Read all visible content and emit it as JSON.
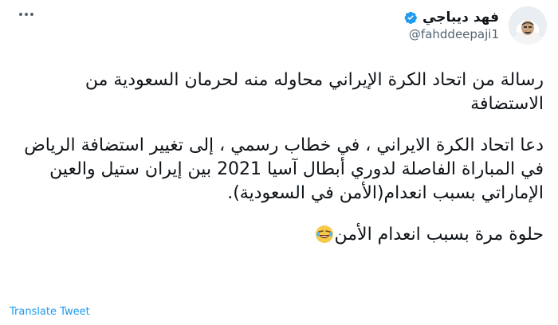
{
  "tweet": {
    "author": {
      "display_name": "فهد ديباجي",
      "handle": "@fahddeepaji1",
      "verified": true
    },
    "paragraphs": [
      "رسالة من اتحاد الكرة الإيراني محاوله منه لحرمان السعودية من الاستضافة",
      "دعا اتحاد الكرة الايراني ، في خطاب رسمي ، إلى تغيير استضافة الرياض في المباراة الفاصلة لدوري أبطال آسيا 2021 بين إيران ستيل والعين الإماراتي بسبب انعدام(الأمن في السعودية).",
      "حلوة مرة بسبب انعدام الأمن"
    ],
    "emoji": "rolling-on-floor-laughing-emoji",
    "translate_label": "Translate Tweet",
    "more_icon": "more-options-icon"
  },
  "colors": {
    "text": "#0f1419",
    "muted": "#536471",
    "link": "#1d9bf0",
    "verified": "#1d9bf0"
  }
}
